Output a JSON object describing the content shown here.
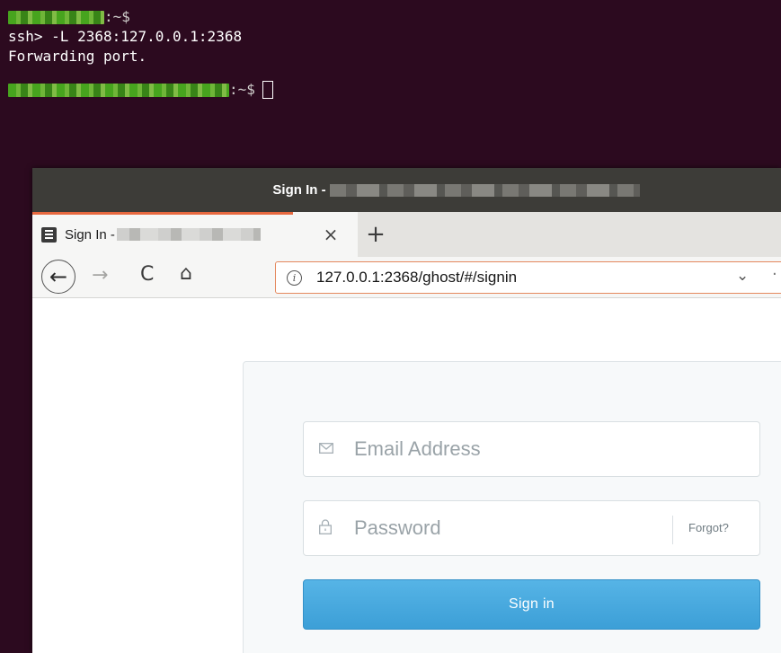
{
  "terminal": {
    "prompt_suffix": ":~$",
    "command_line": "ssh> -L 2368:127.0.0.1:2368",
    "output_line": "Forwarding port."
  },
  "browser": {
    "window_title_prefix": "Sign In -",
    "tab": {
      "title_prefix": "Sign In -",
      "close_glyph": "×"
    },
    "new_tab_glyph": "+",
    "nav": {
      "back_glyph": "←",
      "forward_glyph": "→",
      "reload_glyph": "C",
      "home_glyph": "⌂"
    },
    "url": {
      "info_glyph": "i",
      "text": "127.0.0.1:2368/ghost/#/signin",
      "chevron_glyph": "⌄"
    }
  },
  "signin": {
    "email_placeholder": "Email Address",
    "password_placeholder": "Password",
    "forgot_label": "Forgot?",
    "signin_label": "Sign in",
    "email_icon": "envelope-icon",
    "password_icon": "lock-icon"
  },
  "colors": {
    "terminal_bg": "#2c0a1f",
    "titlebar_bg": "#3d3c38",
    "tab_accent": "#e7683f",
    "url_focus": "#e4885d",
    "button_blue": "#3c9fd7"
  }
}
